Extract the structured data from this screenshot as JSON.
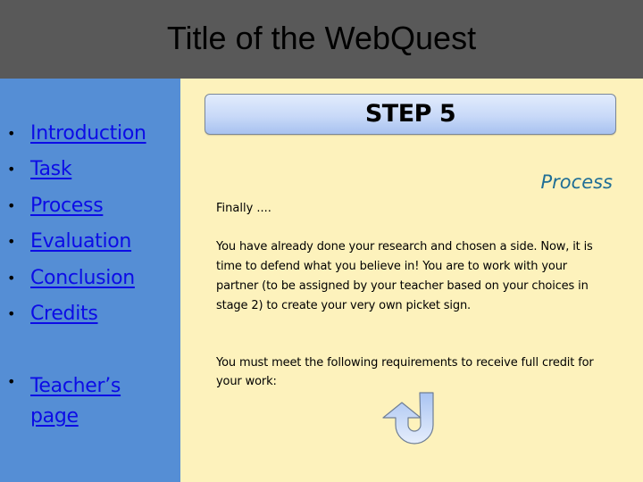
{
  "header": {
    "title": "Title of the WebQuest"
  },
  "sidebar": {
    "items": [
      {
        "label": "Introduction",
        "bullet": "•"
      },
      {
        "label": "Task",
        "bullet": "•"
      },
      {
        "label": "Process",
        "bullet": "•"
      },
      {
        "label": "Evaluation",
        "bullet": "•"
      },
      {
        "label": "Conclusion",
        "bullet": "•"
      },
      {
        "label": "Credits",
        "bullet": "•"
      }
    ],
    "teacher": {
      "label": "Teacher’s page",
      "bullet": "•"
    }
  },
  "main": {
    "step_title": "STEP 5",
    "section_heading": "Process",
    "intro": "Finally ....",
    "paragraph1": "You have already done your research and chosen a side. Now, it is time to defend what you believe in!  You are to work with your partner (to be assigned by your teacher based on your choices in stage 2) to create your very own picket sign.",
    "paragraph2": "You must meet the following requirements to receive full credit for your work:",
    "arrow_icon": "u-turn-arrow-icon"
  },
  "colors": {
    "header_bg": "#595959",
    "sidebar_bg": "#558ED5",
    "content_bg": "#FDF2BC",
    "link": "#0C0CE6",
    "section_heading": "#1F6E96"
  }
}
